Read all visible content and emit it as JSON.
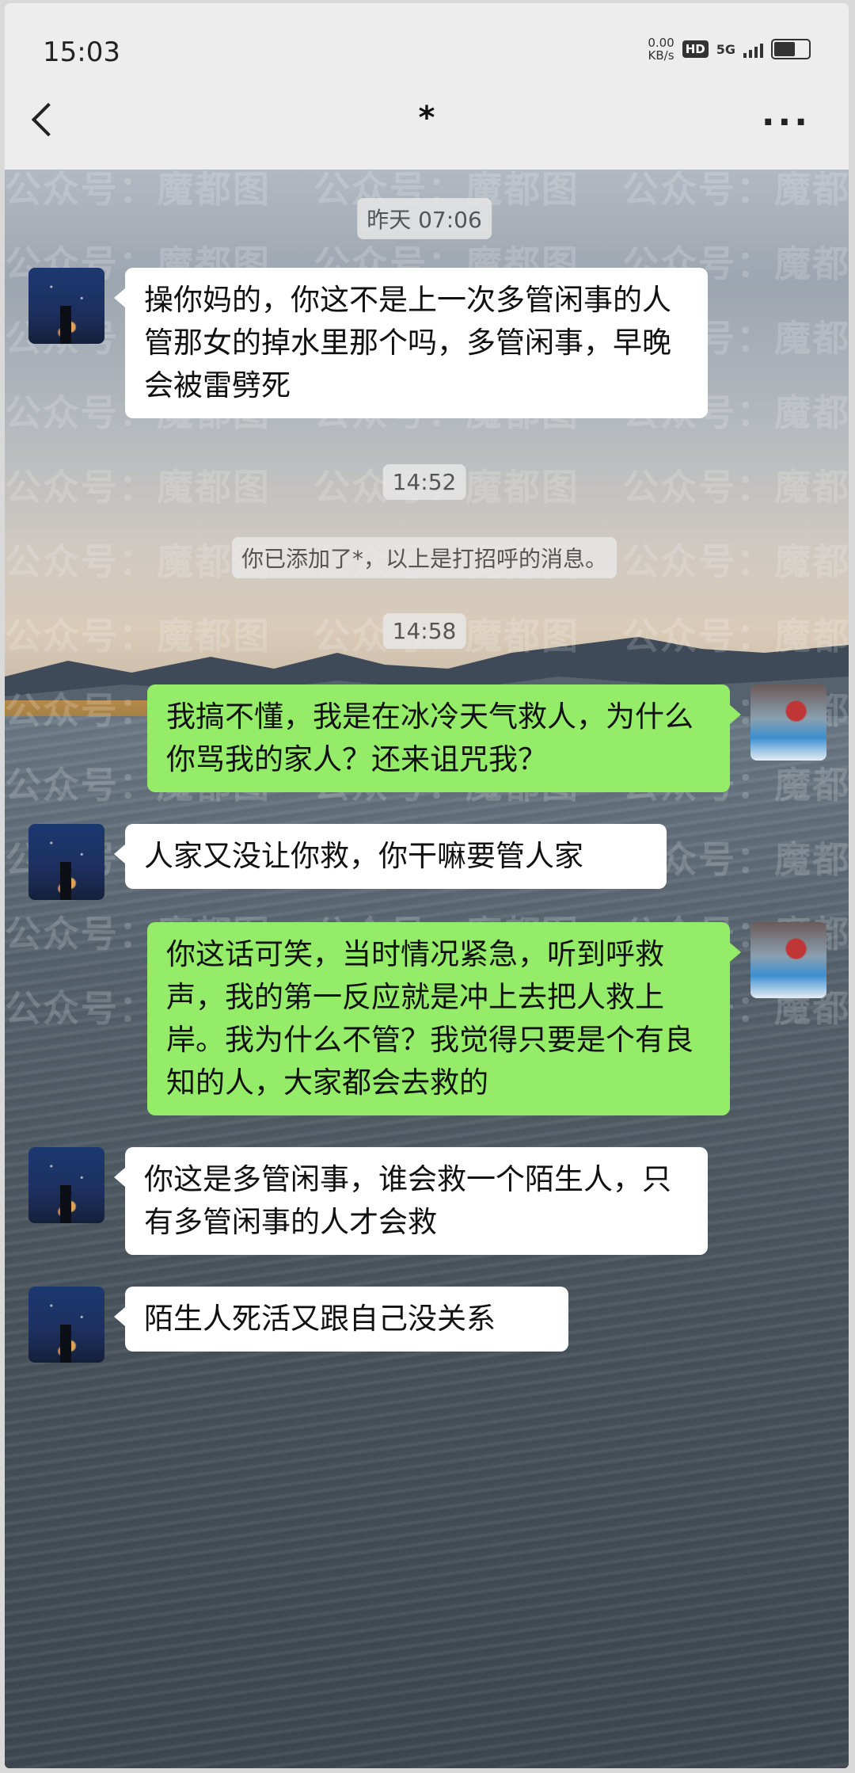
{
  "status_bar": {
    "time": "15:03",
    "net_speed": "0.00",
    "net_unit": "KB/s",
    "hd": "HD",
    "signal": "5G"
  },
  "header": {
    "title": "*",
    "more": "···"
  },
  "watermark": {
    "text": "公众号：魔都图"
  },
  "chat": {
    "timestamps": [
      "昨天 07:06",
      "14:52",
      "14:58"
    ],
    "system_notice": "你已添加了*，以上是打招呼的消息。",
    "messages": [
      {
        "side": "in",
        "text": "操你妈的，你这不是上一次多管闲事的人管那女的掉水里那个吗，多管闲事，早晚会被雷劈死"
      },
      {
        "side": "out",
        "text": "我搞不懂，我是在冰冷天气救人，为什么你骂我的家人？还来诅咒我？"
      },
      {
        "side": "in",
        "text": "人家又没让你救，你干嘛要管人家"
      },
      {
        "side": "out",
        "text": "你这话可笑，当时情况紧急，听到呼救声，我的第一反应就是冲上去把人救上岸。我为什么不管？我觉得只要是个有良知的人，大家都会去救的"
      },
      {
        "side": "in",
        "text": "你这是多管闲事，谁会救一个陌生人，只有多管闲事的人才会救"
      },
      {
        "side": "in",
        "text": "陌生人死活又跟自己没关系"
      }
    ]
  }
}
